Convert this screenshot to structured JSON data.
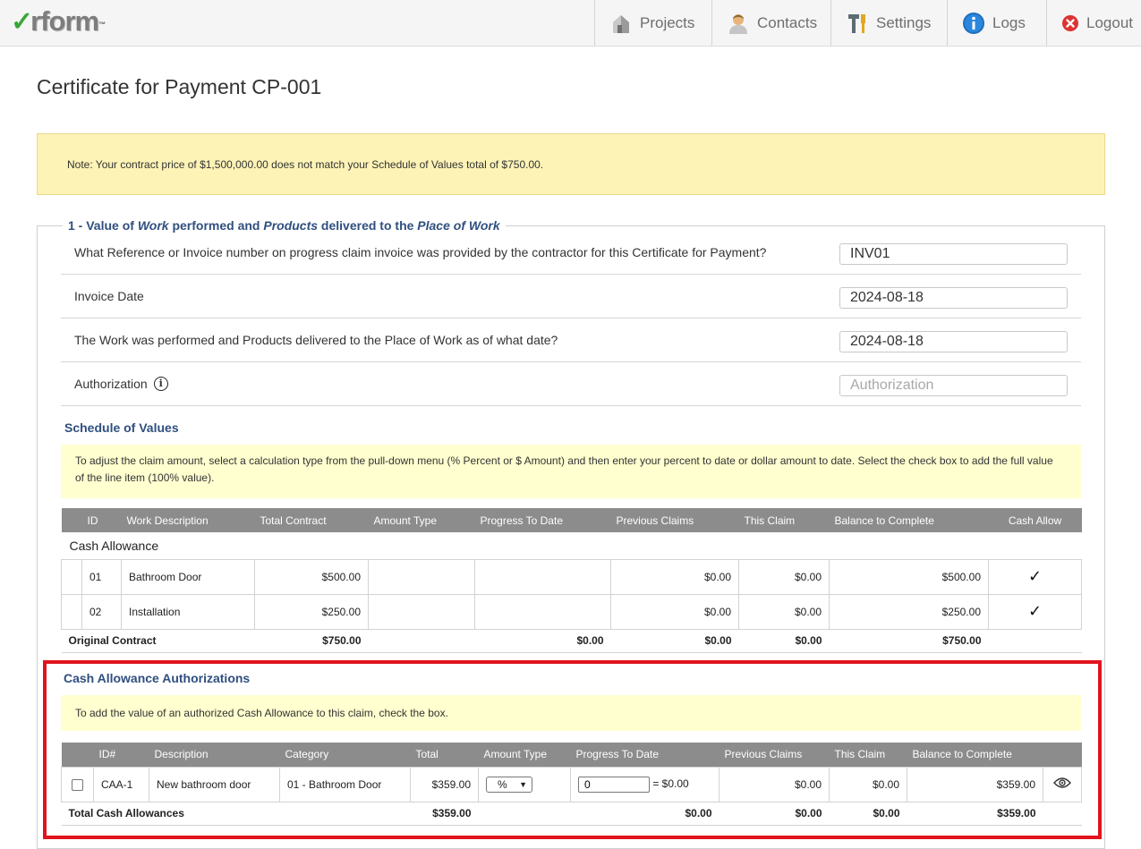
{
  "app": {
    "logo_mark": "✓",
    "logo_text": "rform",
    "logo_tm": "™"
  },
  "nav": {
    "projects": "Projects",
    "contacts": "Contacts",
    "settings": "Settings",
    "logs": "Logs",
    "logout": "Logout"
  },
  "page": {
    "title": "Certificate for Payment CP-001",
    "notice": "Note: Your contract price of $1,500,000.00 does not match your Schedule of Values total of $750.00."
  },
  "section1": {
    "legend_prefix": "1 - Value of ",
    "legend_work": "Work",
    "legend_mid1": " performed and ",
    "legend_products": "Products",
    "legend_mid2": " delivered to the ",
    "legend_place": "Place of Work",
    "questions": [
      {
        "label": "What Reference or Invoice number on progress claim invoice was provided by the contractor for this Certificate for Payment?",
        "value": "INV01",
        "placeholder": ""
      },
      {
        "label": "Invoice Date",
        "value": "2024-08-18",
        "placeholder": ""
      },
      {
        "label": "The Work was performed and Products delivered to the Place of Work as of what date?",
        "value": "2024-08-18",
        "placeholder": ""
      },
      {
        "label": "Authorization",
        "value": "",
        "placeholder": "Authorization"
      }
    ],
    "info_glyph": "i"
  },
  "sov": {
    "heading": "Schedule of Values",
    "help": "To adjust the claim amount, select a calculation type from the pull-down menu (% Percent or $ Amount) and then enter your percent to date or dollar amount to date. Select the check box to add the full value of the line item (100% value).",
    "columns": [
      "ID",
      "Work Description",
      "Total Contract",
      "Amount Type",
      "Progress To Date",
      "Previous Claims",
      "This Claim",
      "Balance to Complete",
      "Cash Allow"
    ],
    "group": "Cash Allowance",
    "rows": [
      {
        "id": "01",
        "description": "Bathroom Door",
        "total_contract": "$500.00",
        "amount_type": "",
        "progress": "",
        "previous": "$0.00",
        "this_claim": "$0.00",
        "balance": "$500.00",
        "cash_allow": "✓"
      },
      {
        "id": "02",
        "description": "Installation",
        "total_contract": "$250.00",
        "amount_type": "",
        "progress": "",
        "previous": "$0.00",
        "this_claim": "$0.00",
        "balance": "$250.00",
        "cash_allow": "✓"
      }
    ],
    "total": {
      "label": "Original Contract",
      "total_contract": "$750.00",
      "progress": "$0.00",
      "previous": "$0.00",
      "this_claim": "$0.00",
      "balance": "$750.00"
    }
  },
  "caa": {
    "heading": "Cash Allowance Authorizations",
    "help": "To add the value of an authorized Cash Allowance to this claim, check the box.",
    "columns": [
      "",
      "ID#",
      "Description",
      "Category",
      "Total",
      "Amount Type",
      "Progress To Date",
      "Previous Claims",
      "This Claim",
      "Balance to Complete",
      ""
    ],
    "rows": [
      {
        "id": "CAA-1",
        "description": "New bathroom door",
        "category": "01 - Bathroom Door",
        "total": "$359.00",
        "amount_type": "%",
        "progress_value": "0",
        "progress_result": "= $0.00",
        "previous": "$0.00",
        "this_claim": "$0.00",
        "balance": "$359.00"
      }
    ],
    "total": {
      "label": "Total Cash Allowances",
      "total": "$359.00",
      "progress": "$0.00",
      "previous": "$0.00",
      "this_claim": "$0.00",
      "balance": "$359.00"
    }
  },
  "colors": {
    "brand_green": "#3aa638",
    "heading_blue": "#2f4f7f",
    "notice_yellow": "#fdf3b6",
    "help_yellow": "#ffffcf",
    "table_header_gray": "#8c8c8c",
    "highlight_red": "#e0141e"
  }
}
